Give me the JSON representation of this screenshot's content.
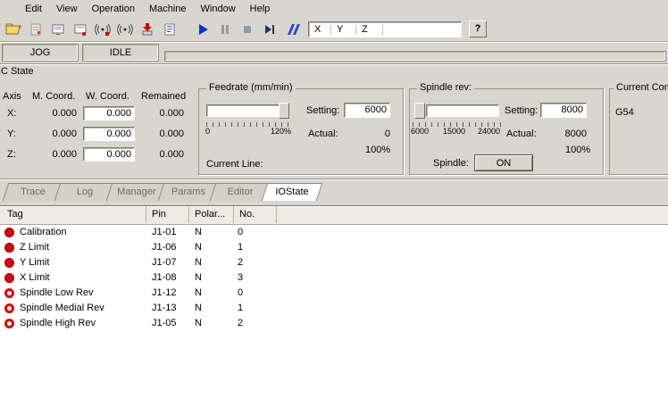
{
  "menu": {
    "items": [
      "Edit",
      "View",
      "Operation",
      "Machine",
      "Window",
      "Help"
    ]
  },
  "toolbar": {
    "icon_names": [
      "open-file-icon",
      "new-file-icon",
      "trace-window-icon",
      "screen-monitor-icon",
      "simulate-icon",
      "wireless-icon",
      "download-to-machine-icon",
      "edit-program-icon",
      "start-icon",
      "pause-icon",
      "stop-icon",
      "step-icon",
      "skip-icon",
      "help-icon"
    ],
    "axis_display": [
      "X",
      "Y",
      "Z"
    ],
    "help_label": "?"
  },
  "status_bar": {
    "mode": "JOG",
    "state": "IDLE"
  },
  "nc_state": {
    "title": "NC State",
    "coord_table": {
      "headers": [
        "Axis",
        "M. Coord.",
        "W. Coord.",
        "Remained"
      ],
      "rows": [
        {
          "axis": "X:",
          "m_coord": "0.000",
          "w_coord": "0.000",
          "remained": "0.000"
        },
        {
          "axis": "Y:",
          "m_coord": "0.000",
          "w_coord": "0.000",
          "remained": "0.000"
        },
        {
          "axis": "Z:",
          "m_coord": "0.000",
          "w_coord": "0.000",
          "remained": "0.000"
        }
      ]
    },
    "feedrate": {
      "title": "Feedrate (mm/min)",
      "setting_label": "Setting:",
      "setting_value": "6000",
      "actual_label": "Actual:",
      "actual_value": "0",
      "percent": "100%",
      "scale_start": "0",
      "scale_end": "120%",
      "current_line_label": "Current Line:"
    },
    "spindle": {
      "title": "Spindle rev:",
      "setting_label": "Setting:",
      "setting_value": "8000",
      "actual_label": "Actual:",
      "actual_value": "8000",
      "percent": "100%",
      "scale_ticks": [
        "6000",
        "15000",
        "24000"
      ],
      "spindle_label": "Spindle:",
      "on_button_label": "ON"
    },
    "current_command": {
      "title": "Current Com",
      "value": "G54"
    }
  },
  "bottom_tabs": [
    {
      "label": "Trace",
      "active": false
    },
    {
      "label": "Log",
      "active": false
    },
    {
      "label": "Manager",
      "active": false
    },
    {
      "label": "Params",
      "active": false
    },
    {
      "label": "Editor",
      "active": false
    },
    {
      "label": "IOState",
      "active": true
    }
  ],
  "io_state": {
    "headers": [
      "Tag",
      "Pin",
      "Polar...",
      "No."
    ],
    "rows": [
      {
        "tag": "Calibration",
        "pin": "J1-01",
        "polarity": "N",
        "no": "0",
        "indicator": "solid"
      },
      {
        "tag": "Z Limit",
        "pin": "J1-06",
        "polarity": "N",
        "no": "1",
        "indicator": "solid"
      },
      {
        "tag": "Y Limit",
        "pin": "J1-07",
        "polarity": "N",
        "no": "2",
        "indicator": "solid"
      },
      {
        "tag": "X Limit",
        "pin": "J1-08",
        "polarity": "N",
        "no": "3",
        "indicator": "solid"
      },
      {
        "tag": "Spindle Low Rev",
        "pin": "J1-12",
        "polarity": "N",
        "no": "0",
        "indicator": "hollow"
      },
      {
        "tag": "Spindle Medial Rev",
        "pin": "J1-13",
        "polarity": "N",
        "no": "1",
        "indicator": "hollow"
      },
      {
        "tag": "Spindle High Rev",
        "pin": "J1-05",
        "polarity": "N",
        "no": "2",
        "indicator": "hollow"
      }
    ]
  },
  "colors": {
    "window_bg": "#d9d6cf",
    "indicator_red": "#dd0000",
    "play_blue": "#0038d0"
  }
}
